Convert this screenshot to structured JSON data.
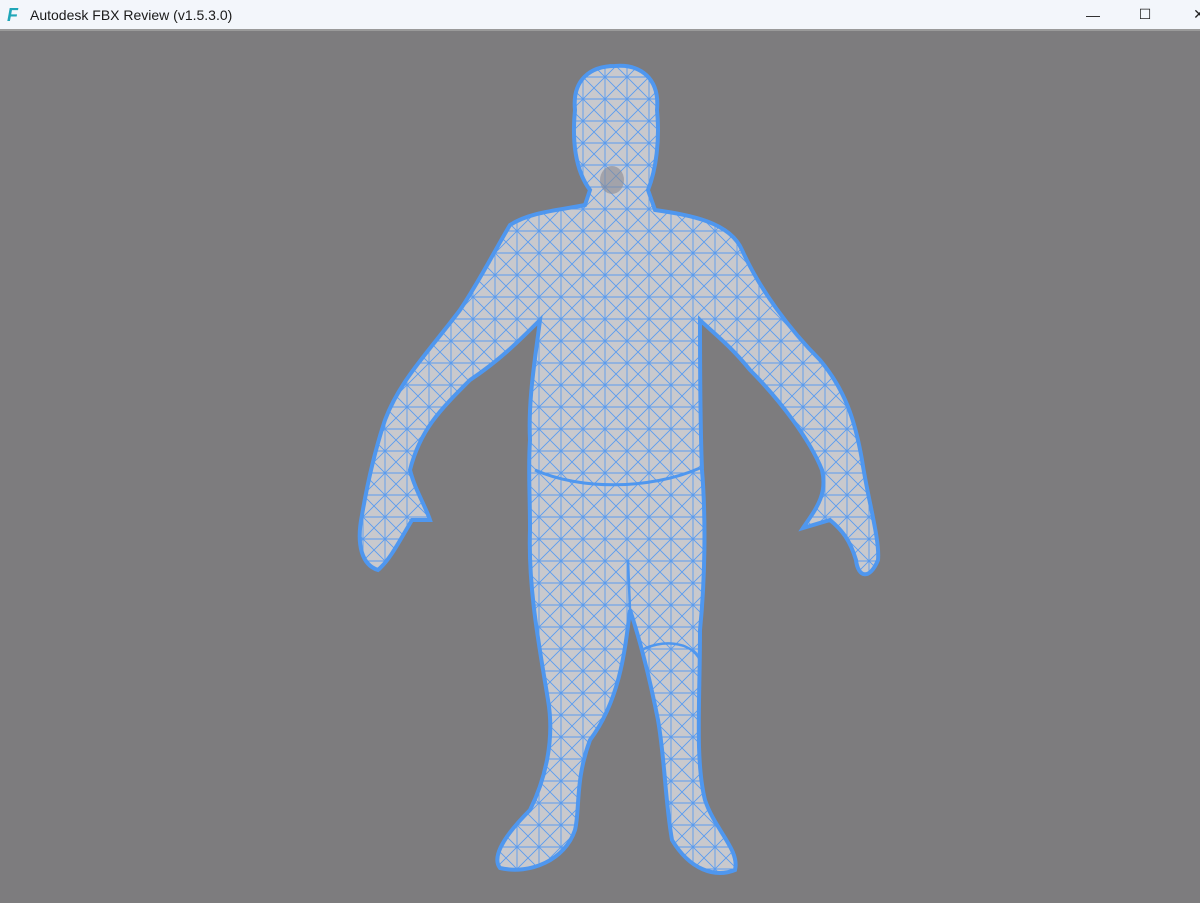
{
  "window": {
    "title": "Autodesk FBX Review (v1.5.3.0)",
    "app_icon": "F",
    "controls": {
      "minimize": "—",
      "maximize": "☐",
      "close": "✕"
    }
  },
  "viewport": {
    "background": "#7d7c7e",
    "mesh_fill": "#c9c9cd",
    "wire_color": "#4f97ef",
    "display_mode": "wireframe-on-shaded"
  }
}
